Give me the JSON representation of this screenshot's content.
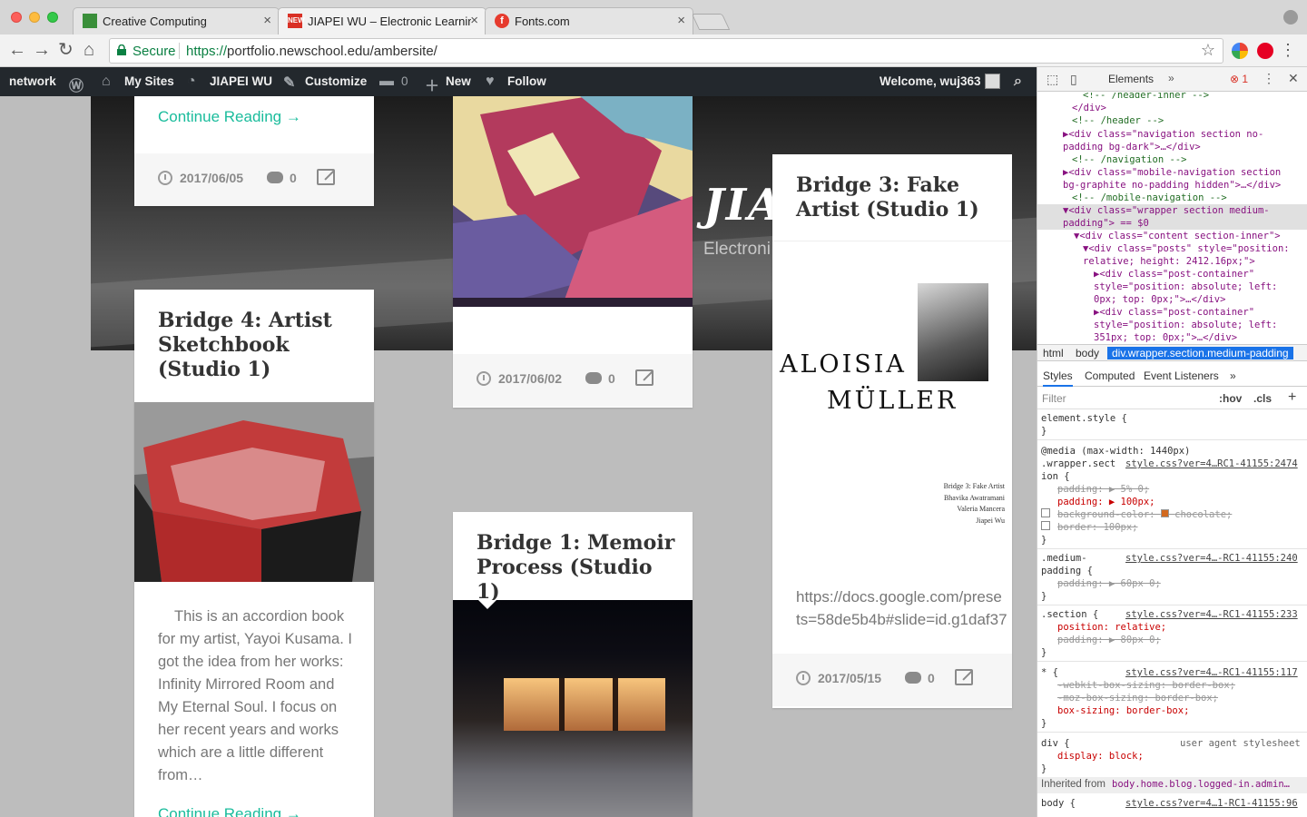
{
  "browser": {
    "tabs": [
      {
        "title": "Creative Computing",
        "favicon_color": "#3a8f3a"
      },
      {
        "title": "JIAPEI WU – Electronic Learnin",
        "favicon_color": "#d93025",
        "active": true
      },
      {
        "title": "Fonts.com",
        "favicon_color": "#e63b2e"
      }
    ],
    "tab_close_glyph": "×",
    "new_tab_favicon_label": "NEW",
    "fonts_favicon_label": "f",
    "secure_label": "Secure",
    "url_scheme": "https://",
    "url_rest": "portfolio.newschool.edu/ambersite/"
  },
  "admin_bar": {
    "network": "network",
    "my_sites": "My Sites",
    "site_name": "JIAPEI WU",
    "customize": "Customize",
    "comments_count": "0",
    "new": "New",
    "follow": "Follow",
    "welcome": "Welcome, wuj363"
  },
  "hero": {
    "title": "JIA",
    "subtitle": "Electroni"
  },
  "posts": {
    "top_left": {
      "read_more": "Continue Reading →",
      "date": "2017/06/05",
      "comments": "0"
    },
    "middle_top": {
      "date": "2017/06/02",
      "comments": "0"
    },
    "bridge3": {
      "title": "Bridge 3: Fake Artist (Studio 1)",
      "image_text_1": "ALOISIA",
      "image_text_2": "MÜLLER",
      "credits": [
        "Bridge 3: Fake Artist",
        "Bhavika Awatramani",
        "Valeria Mancera",
        "Jiapei Wu"
      ],
      "excerpt": "https://docs.google.com/prese ts=58de5b4b#slide=id.g1daf37",
      "date": "2017/05/15",
      "comments": "0"
    },
    "bridge4": {
      "title": "Bridge 4: Artist Sketchbook (Studio 1)",
      "excerpt": "This is an accordion book for my artist, Yayoi Kusama. I got the idea from her works: Infinity Mirrored Room and My Eternal Soul. I focus on her recent years and works which are a little different from…",
      "read_more": "Continue Reading →"
    },
    "bridge1": {
      "title": "Bridge 1: Memoir Process (Studio 1)"
    }
  },
  "devtools": {
    "tab": "Elements",
    "more": "»",
    "errors": "1",
    "dom_lines": [
      "<!-- /header-inner -->",
      "</div>",
      "<!-- /header -->",
      "<div class=\"navigation section no-padding bg-dark\">…</div>",
      "<!-- /navigation -->",
      "<div class=\"mobile-navigation section bg-graphite no-padding hidden\">…</div>",
      "<!-- /mobile-navigation -->",
      "<div class=\"wrapper section medium-padding\"> == $0",
      "<div class=\"content section-inner\">",
      "<div class=\"posts\" style=\"position: relative; height: 2412.16px;\">",
      "<div class=\"post-container\" style=\"position: absolute; left: 0px; top: 0px;\">…</div>",
      "<div class=\"post-container\" style=\"position: absolute; left: 351px; top: 0px;\">…</div>"
    ],
    "breadcrumbs": [
      "html",
      "body",
      "div.wrapper.section.medium-padding"
    ],
    "subtabs": [
      "Styles",
      "Computed",
      "Event Listeners",
      "»"
    ],
    "filter_placeholder": "Filter",
    "hov": ":hov",
    "cls": ".cls",
    "plus": "+",
    "styles": {
      "element_style": "element.style {",
      "media": "@media (max-width: 1440px)",
      "wrapper_selector": ".wrapper.sect",
      "wrapper_selector_2": "ion {",
      "wrapper_link": "style.css?ver=4…RC1-41155:2474",
      "padding_struck": "padding: ▶ 5% 0;",
      "padding": "padding: ▶ 100px;",
      "bg_struck": "background-color: ",
      "bg_value": "chocolate;",
      "border_struck": "border: 100px;",
      "medium_selector": ".medium-",
      "medium_selector_2": "padding {",
      "medium_link": "style.css?ver=4…-RC1-41155:240",
      "medium_padding": "padding: ▶ 60px 0;",
      "section_selector": ".section {",
      "section_link": "style.css?ver=4…-RC1-41155:233",
      "section_position": "position: relative;",
      "section_padding": "padding: ▶ 80px 0;",
      "star_selector": "* {",
      "star_link": "style.css?ver=4…-RC1-41155:117",
      "webkit_bs": "-webkit-box-sizing: border-box;",
      "moz_bs": "-moz-box-sizing: border-box;",
      "bs": "box-sizing: border-box;",
      "div_selector": "div {",
      "ua": "user agent stylesheet",
      "div_display": "display: block;",
      "inherited_label": "Inherited from",
      "inherited_value": "body.home.blog.logged-in.admin…",
      "body_selector": "body {",
      "body_link": "style.css?ver=4…1-RC1-41155:96",
      "close_brace": "}"
    }
  }
}
